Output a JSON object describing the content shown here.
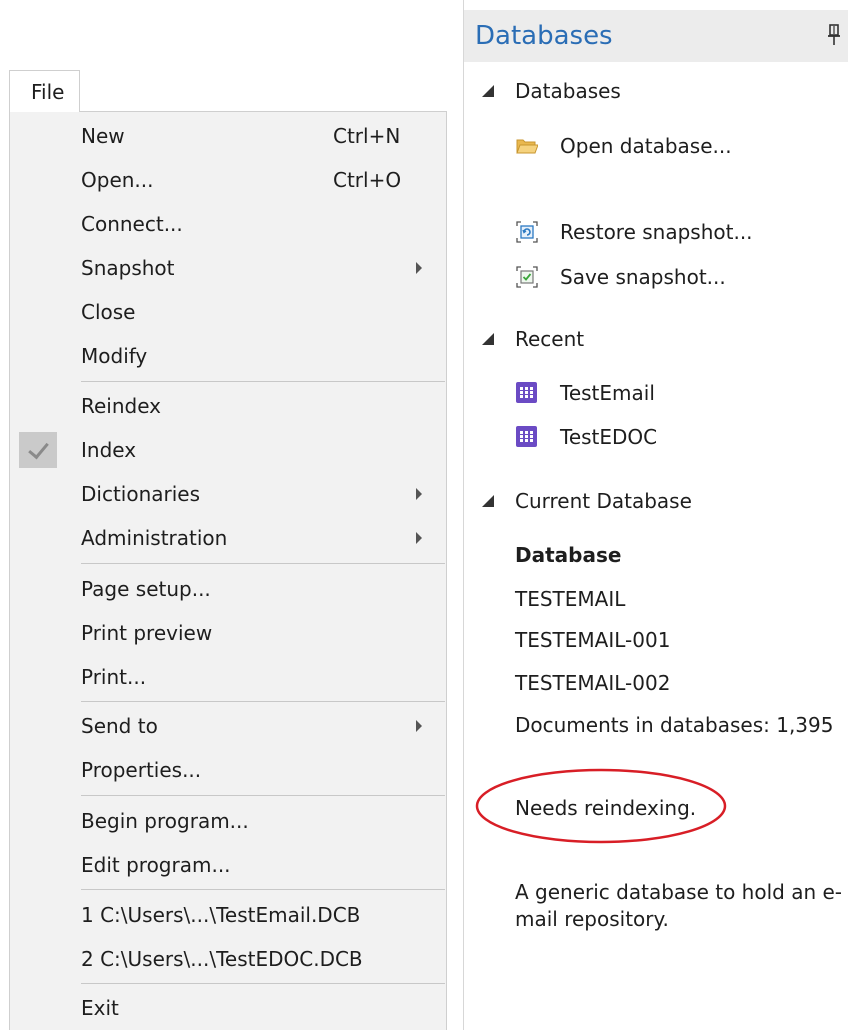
{
  "file_menu": {
    "tab_label": "File",
    "items": [
      {
        "label": "New",
        "shortcut": "Ctrl+N"
      },
      {
        "label": "Open...",
        "shortcut": "Ctrl+O"
      },
      {
        "label": "Connect..."
      },
      {
        "label": "Snapshot",
        "has_submenu": true
      },
      {
        "label": "Close"
      },
      {
        "label": "Modify"
      },
      {
        "label": "Reindex"
      },
      {
        "label": "Index",
        "checked": true
      },
      {
        "label": "Dictionaries",
        "has_submenu": true
      },
      {
        "label": "Administration",
        "has_submenu": true
      },
      {
        "label": "Page setup..."
      },
      {
        "label": "Print preview"
      },
      {
        "label": "Print..."
      },
      {
        "label": "Send to",
        "has_submenu": true
      },
      {
        "label": "Properties..."
      },
      {
        "label": "Begin program..."
      },
      {
        "label": "Edit program..."
      },
      {
        "label": "1 C:\\Users\\...\\TestEmail.DCB"
      },
      {
        "label": "2 C:\\Users\\...\\TestEDOC.DCB"
      },
      {
        "label": "Exit"
      }
    ]
  },
  "databases_panel": {
    "title": "Databases",
    "pin_icon": "pin-icon",
    "sections": {
      "databases": {
        "label": "Databases",
        "links": [
          {
            "label": "Open database...",
            "icon": "folder-icon"
          },
          {
            "label": "Restore snapshot...",
            "icon": "restore-snapshot-icon"
          },
          {
            "label": "Save snapshot...",
            "icon": "save-snapshot-icon"
          }
        ]
      },
      "recent": {
        "label": "Recent",
        "items": [
          {
            "label": "TestEmail",
            "icon": "database-grid-icon"
          },
          {
            "label": "TestEDOC",
            "icon": "database-grid-icon"
          }
        ]
      },
      "current": {
        "label": "Current Database",
        "heading": "Database",
        "names": [
          "TESTEMAIL",
          "TESTEMAIL-001",
          "TESTEMAIL-002"
        ],
        "documents": "Documents in databases: 1,395",
        "status": "Needs reindexing.",
        "description": "A generic database to hold an e-mail repository."
      }
    }
  },
  "colors": {
    "title_blue": "#2a6db5",
    "menu_background": "#f2f2f2",
    "highlight_red": "#d81e26",
    "database_icon_purple": "#6b4bc4",
    "folder_yellow": "#f1c86a",
    "snapshot_blue": "#2b79c2",
    "snapshot_green": "#3aa63a"
  }
}
